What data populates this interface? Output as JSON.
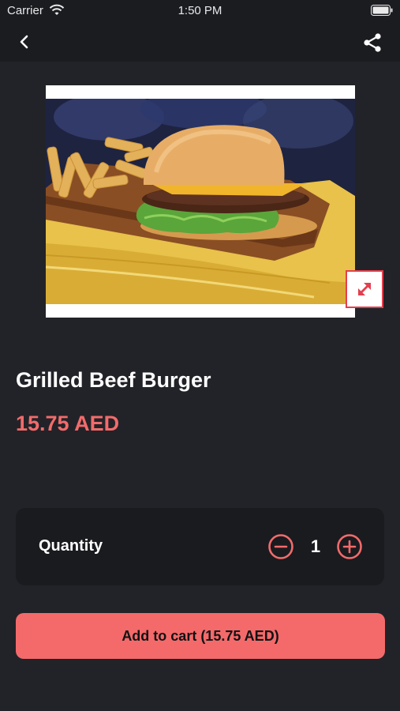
{
  "status_bar": {
    "carrier": "Carrier",
    "time": "1:50 PM",
    "icons": [
      "wifi-icon",
      "battery-icon"
    ]
  },
  "nav": {
    "icons": [
      "back-chevron-icon",
      "share-icon"
    ]
  },
  "product": {
    "name": "Grilled Beef Burger",
    "price": "15.75 AED",
    "image_icon": "expand-icon"
  },
  "quantity": {
    "label": "Quantity",
    "value": "1",
    "icons": [
      "minus-circle-icon",
      "plus-circle-icon"
    ]
  },
  "cart": {
    "button_label": "Add to cart (15.75 AED)"
  },
  "colors": {
    "background": "#222328",
    "accent": "#f46a6a",
    "price": "#f26b6b",
    "card": "#1a1b1f"
  }
}
